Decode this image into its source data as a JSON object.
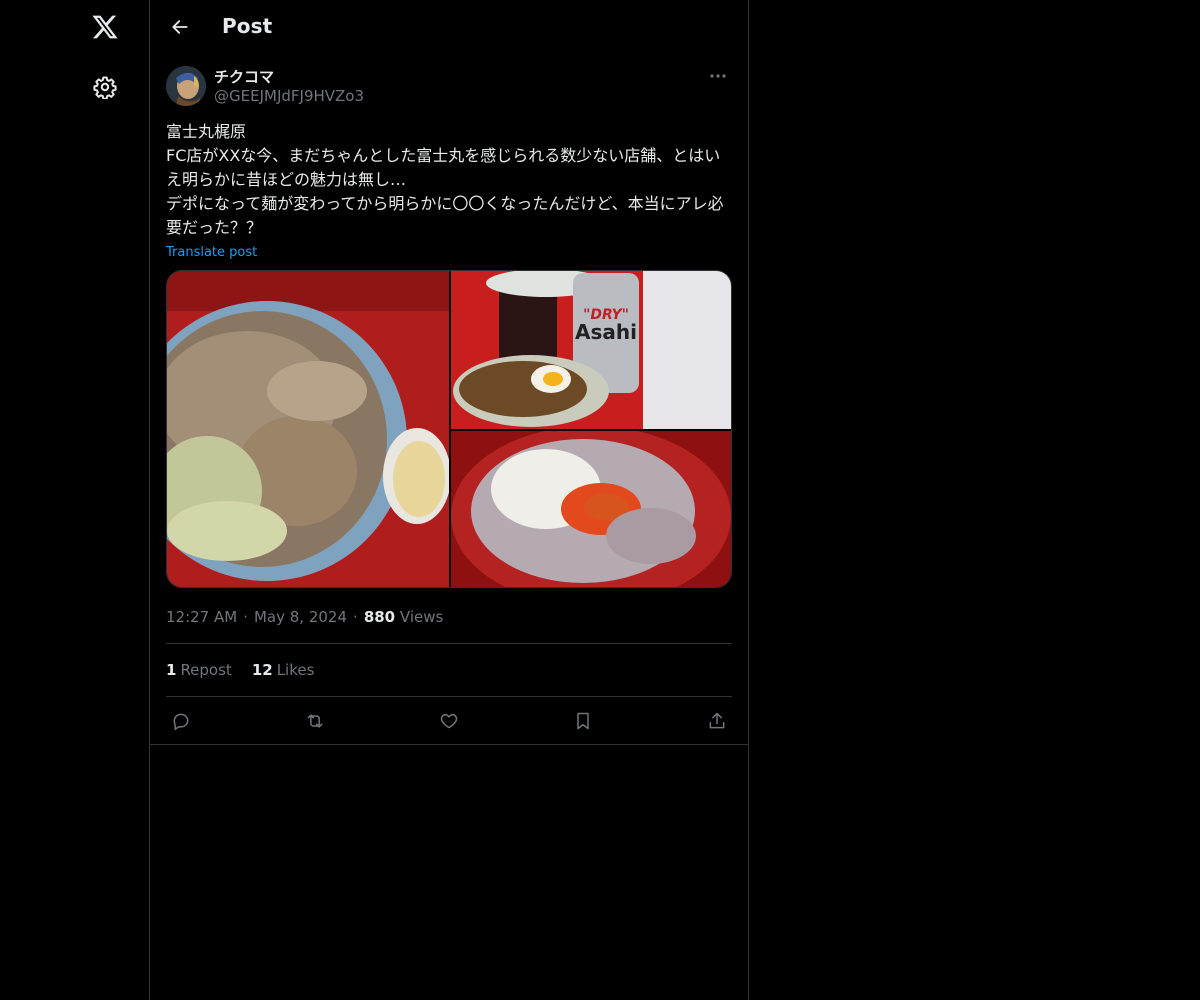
{
  "nav": {
    "logo_icon": "x-logo-icon",
    "settings_icon": "gear-icon"
  },
  "header": {
    "title": "Post",
    "back_icon": "arrow-left-icon"
  },
  "post": {
    "author_name": "チクコマ",
    "author_handle": "@GEEJMJdFJ9HVZo3",
    "text": "富士丸梶原\nFC店がXXな今、まだちゃんとした富士丸を感じられる数少ない店舗、とはいえ明らかに昔ほどの魅力は無し…\nデポになって麺が変わってから明らかに〇〇くなったんだけど、本当にアレ必要だった？？",
    "translate_label": "Translate post",
    "media_count": 3,
    "time": "12:27 AM",
    "date": "May 8, 2024",
    "views_count": "880",
    "views_label": "Views",
    "reposts_count": "1",
    "reposts_label": "Repost",
    "likes_count": "12",
    "likes_label": "Likes"
  },
  "actions": [
    "reply-icon",
    "repost-icon",
    "like-icon",
    "bookmark-icon",
    "share-icon"
  ],
  "colors": {
    "background": "#000000",
    "text": "#e7e9ea",
    "secondary": "#71767b",
    "link": "#1d9bf0",
    "border": "#2f3336"
  }
}
